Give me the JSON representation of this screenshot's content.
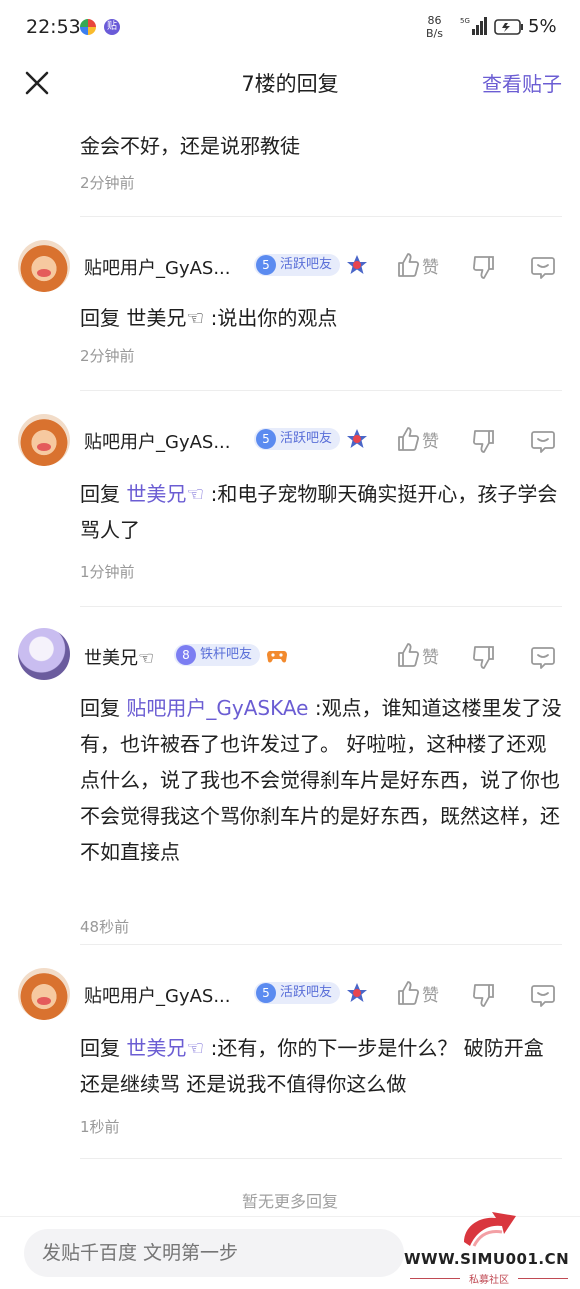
{
  "status_bar": {
    "time": "22:53",
    "app_icon_label": "贴",
    "net_speed_value": "86",
    "net_speed_unit": "B/s",
    "battery": "5%"
  },
  "header": {
    "title": "7楼的回复",
    "view_post": "查看贴子"
  },
  "partial_reply": {
    "text": "金会不好，还是说邪教徒",
    "time": "2分钟前"
  },
  "replies": [
    {
      "username": "贴吧用户_GyAS...",
      "level": "5",
      "level_title": "活跃吧友",
      "like_label": "赞",
      "reply_prefix": "回复 ",
      "reply_to": "世美兄☜",
      "reply_text": " :说出你的观点",
      "time": "2分钟前"
    },
    {
      "username": "贴吧用户_GyAS...",
      "level": "5",
      "level_title": "活跃吧友",
      "like_label": "赞",
      "reply_prefix": "回复 ",
      "reply_to": "世美兄☜",
      "reply_text": " :和电子宠物聊天确实挺开心，孩子学会骂人了",
      "time": "1分钟前"
    },
    {
      "username": "世美兄☜",
      "level": "8",
      "level_title": "铁杆吧友",
      "like_label": "赞",
      "reply_prefix": "回复 ",
      "reply_to": "贴吧用户_GyASKAe",
      "reply_text": " :观点，谁知道这楼里发了没有，也许被吞了也许发过了。 好啦啦，这种楼了还观点什么，说了我也不会觉得刹车片是好东西，说了你也不会觉得我这个骂你刹车片的是好东西，既然这样，还不如直接点",
      "time": "48秒前"
    },
    {
      "username": "贴吧用户_GyAS...",
      "level": "5",
      "level_title": "活跃吧友",
      "like_label": "赞",
      "reply_prefix": "回复 ",
      "reply_to": "世美兄☜",
      "reply_text": " :还有，你的下一步是什么？ 破防开盒 还是继续骂 还是说我不值得你这么做",
      "time": "1秒前"
    }
  ],
  "no_more": "暂无更多回复",
  "input_placeholder": "发贴千百度 文明第一步",
  "watermark": {
    "site": "WWW.SIMU001.CN",
    "sub": "私募社区"
  },
  "colors": {
    "accent": "#6b5dd3",
    "muted": "#999999",
    "badge_bg": "#e7ecfb"
  }
}
